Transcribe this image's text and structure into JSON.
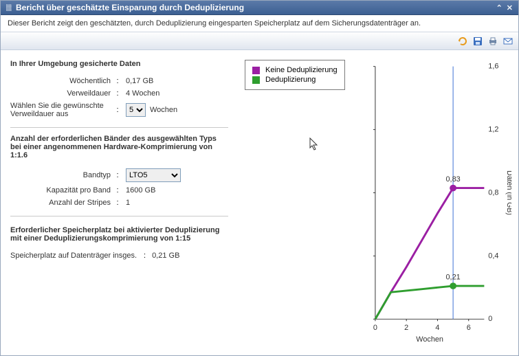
{
  "window": {
    "title": "Bericht über geschätzte Einsparung durch Deduplizierung",
    "description": "Dieser Bericht zeigt den geschätzten, durch Deduplizierung eingesparten Speicherplatz auf dem Sicherungsdatenträger an."
  },
  "toolbar_icons": {
    "refresh": "refresh-icon",
    "save": "save-icon",
    "print": "print-icon",
    "email": "email-icon"
  },
  "sections": {
    "env": {
      "title": "In Ihrer Umgebung gesicherte Daten",
      "weekly_label": "Wöchentlich",
      "weekly_value": "0,17  GB",
      "retention_label": "Verweildauer",
      "retention_value": "4  Wochen",
      "choose_label": "Wählen Sie die gewünschte Verweildauer aus",
      "choose_value": "5",
      "choose_unit": "Wochen"
    },
    "tapes": {
      "title": "Anzahl der erforderlichen Bänder des ausgewählten Typs bei einer angenommenen Hardware-Komprimierung von 1:1.6",
      "type_label": "Bandtyp",
      "type_value": "LTO5",
      "capacity_label": "Kapazität pro Band",
      "capacity_value": "1600  GB",
      "stripes_label": "Anzahl der Stripes",
      "stripes_value": "1"
    },
    "dedup": {
      "title": "Erforderlicher Speicherplatz bei aktivierter Deduplizierung mit einer Deduplizierungskomprimierung von 1:15",
      "total_label": "Speicherplatz auf Datenträger insges.",
      "total_value": "0,21  GB"
    }
  },
  "chart_data": {
    "type": "line",
    "title": "",
    "xlabel": "Wochen",
    "ylabel": "Daten (in GB)",
    "xlim": [
      0,
      7
    ],
    "ylim": [
      0,
      1.6
    ],
    "x_ticks": [
      0,
      2,
      4,
      6
    ],
    "y_ticks": [
      0,
      0.4,
      0.8,
      1.2,
      1.6
    ],
    "marker_x": 5,
    "series": [
      {
        "name": "Keine Deduplizierung",
        "color": "#9b1fa3",
        "x": [
          0,
          1,
          2,
          3,
          4,
          5,
          6,
          7
        ],
        "values": [
          0,
          0.17,
          0.33,
          0.5,
          0.67,
          0.83,
          0.83,
          0.83
        ],
        "label_point": {
          "x": 5,
          "y": 0.83,
          "text": "0,83"
        }
      },
      {
        "name": "Deduplizierung",
        "color": "#2f9e2f",
        "x": [
          0,
          1,
          2,
          3,
          4,
          5,
          6,
          7
        ],
        "values": [
          0,
          0.17,
          0.18,
          0.19,
          0.2,
          0.21,
          0.21,
          0.21
        ],
        "label_point": {
          "x": 5,
          "y": 0.21,
          "text": "0,21"
        }
      }
    ],
    "legend_labels": {
      "none": "Keine Deduplizierung",
      "dedup": "Deduplizierung"
    }
  }
}
